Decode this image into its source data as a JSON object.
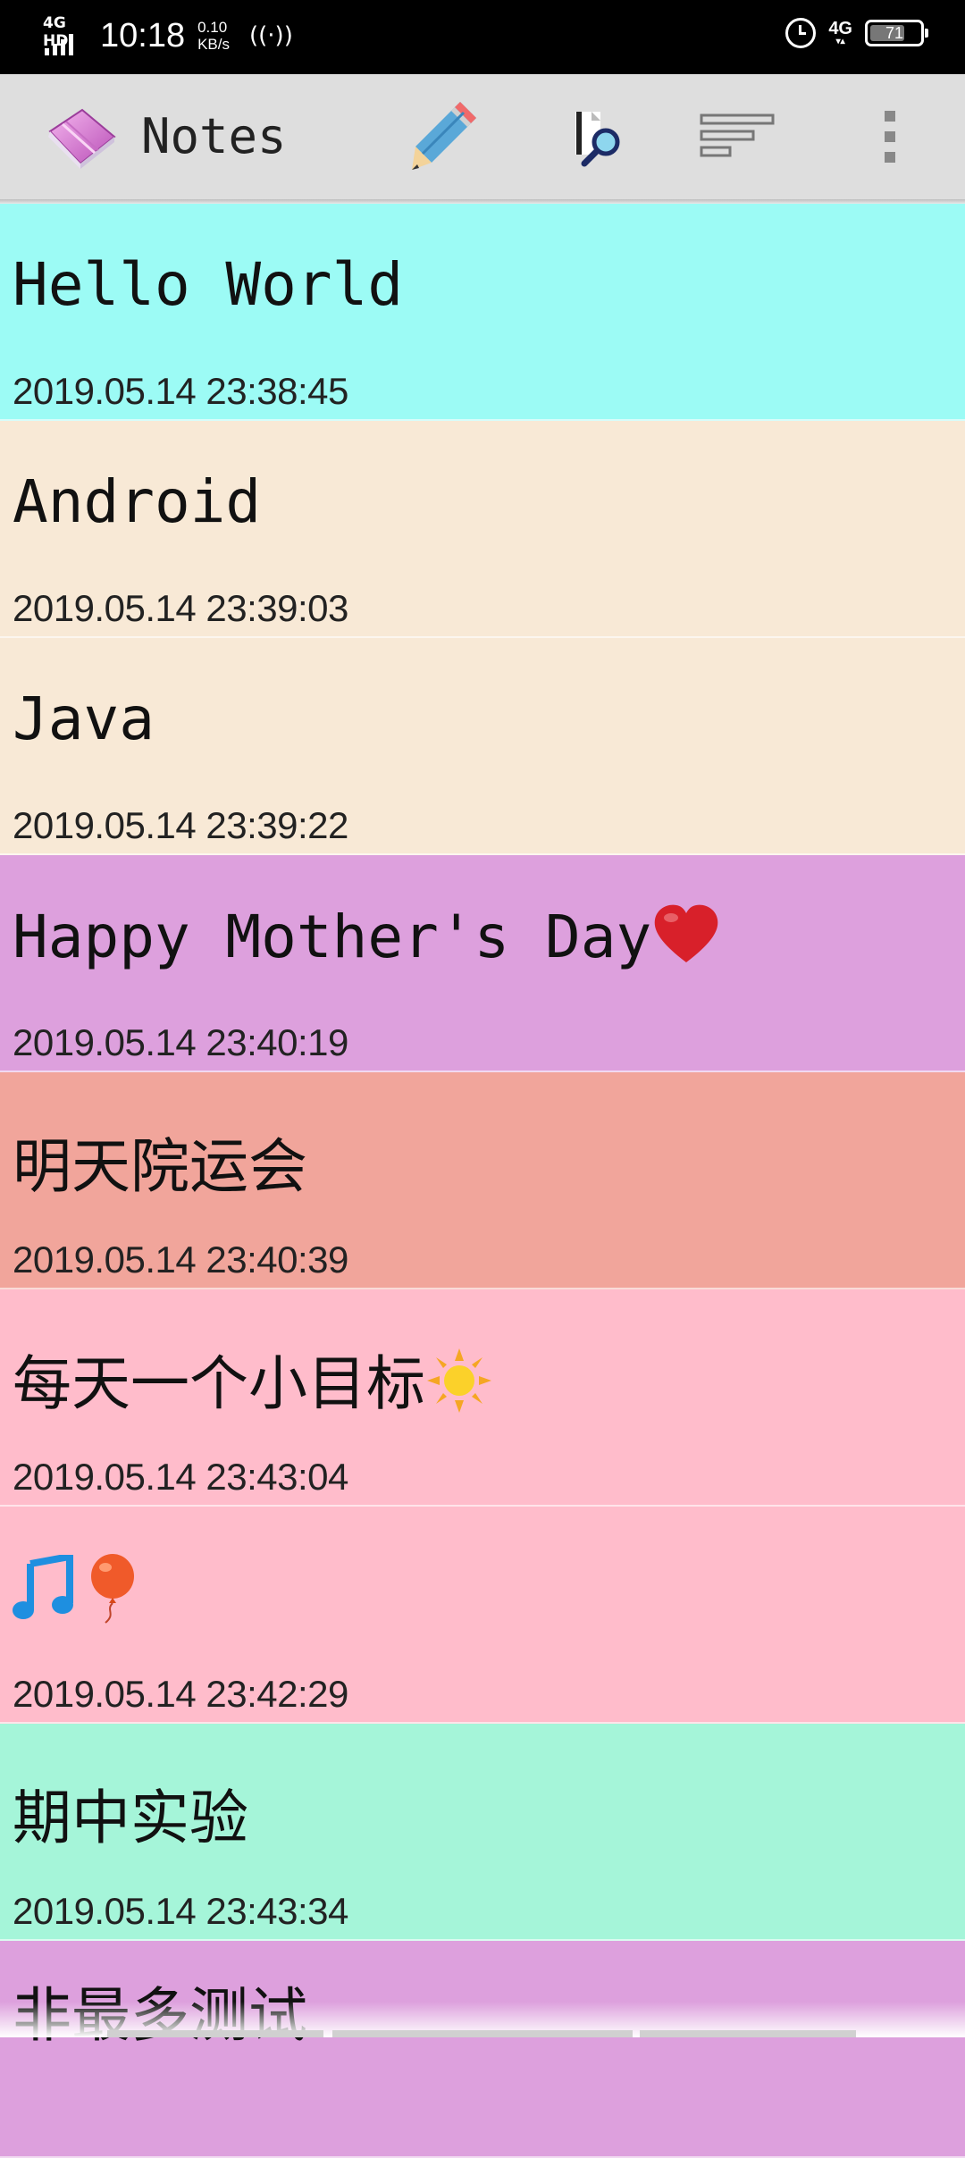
{
  "status_bar": {
    "signal_label": "4G HD",
    "time": "10:18",
    "speed_value": "0.10",
    "speed_unit": "KB/s",
    "network": "4G",
    "battery": "71",
    "battery_level": 0.71,
    "icons": [
      "signal-icon",
      "hotspot-icon",
      "alarm-icon",
      "network-4g-icon",
      "battery-icon"
    ]
  },
  "action_bar": {
    "title": "Notes",
    "icons": [
      "app-notebook-icon",
      "pencil-icon",
      "search-icon",
      "sort-icon",
      "more-icon"
    ]
  },
  "notes": [
    {
      "title": "Hello World",
      "date": "2019.05.14 23:38:45",
      "color": "#9CFBF5"
    },
    {
      "title": "Android",
      "date": "2019.05.14 23:39:03",
      "color": "#F8E9D6"
    },
    {
      "title": "Java",
      "date": "2019.05.14 23:39:22",
      "color": "#F8E9D6"
    },
    {
      "title": "Happy Mother's Day",
      "emoji": "heart",
      "date": "2019.05.14 23:40:19",
      "color": "#DDA0DD"
    },
    {
      "title": "明天院运会",
      "date": "2019.05.14 23:40:39",
      "color": "#F1A59B"
    },
    {
      "title": "每天一个小目标",
      "emoji": "sun",
      "date": "2019.05.14 23:43:04",
      "color": "#FFBCCB"
    },
    {
      "title": "",
      "emoji": "music-balloon",
      "date": "2019.05.14 23:42:29",
      "color": "#FFBCCB"
    },
    {
      "title": "期中实验",
      "date": "2019.05.14 23:43:34",
      "color": "#A5F5D9"
    },
    {
      "title": "非最多测试",
      "date": "",
      "color": "#DDA0DD"
    }
  ]
}
